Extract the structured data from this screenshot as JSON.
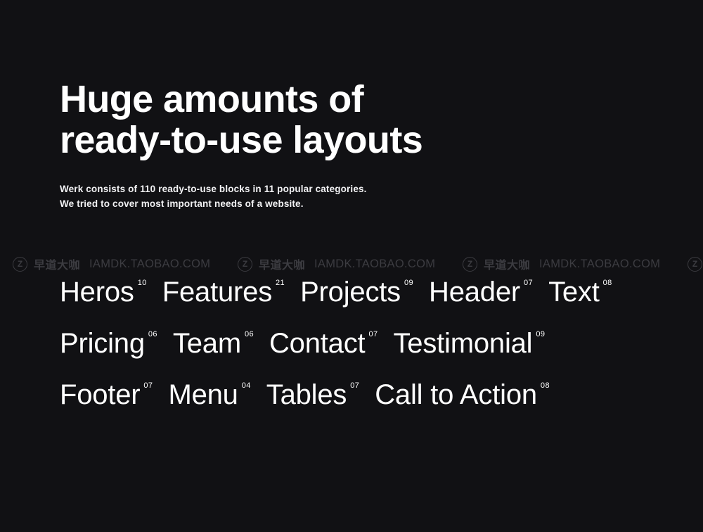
{
  "background_color": "#111114",
  "text_color": "#ffffff",
  "hero": {
    "title": "Huge amounts of\nready-to-use layouts",
    "subtitle": "Werk consists of 110 ready-to-use blocks in 11 popular categories.\nWe tried to cover most important needs of a website."
  },
  "watermark": {
    "logo_letter": "Z",
    "brand_cn": "早道大咖",
    "url": "IAMDK.TAOBAO.COM",
    "color": "#3c3c41"
  },
  "categories": {
    "rows": [
      [
        {
          "label": "Heros",
          "count": "10"
        },
        {
          "label": "Features",
          "count": "21"
        },
        {
          "label": "Projects",
          "count": "09"
        },
        {
          "label": "Header",
          "count": "07"
        },
        {
          "label": "Text",
          "count": "08"
        }
      ],
      [
        {
          "label": "Pricing",
          "count": "06"
        },
        {
          "label": "Team",
          "count": "06"
        },
        {
          "label": "Contact",
          "count": "07"
        },
        {
          "label": "Testimonial",
          "count": "09"
        }
      ],
      [
        {
          "label": "Footer",
          "count": "07"
        },
        {
          "label": "Menu",
          "count": "04"
        },
        {
          "label": "Tables",
          "count": "07"
        },
        {
          "label": "Call to Action",
          "count": "08"
        }
      ]
    ]
  }
}
